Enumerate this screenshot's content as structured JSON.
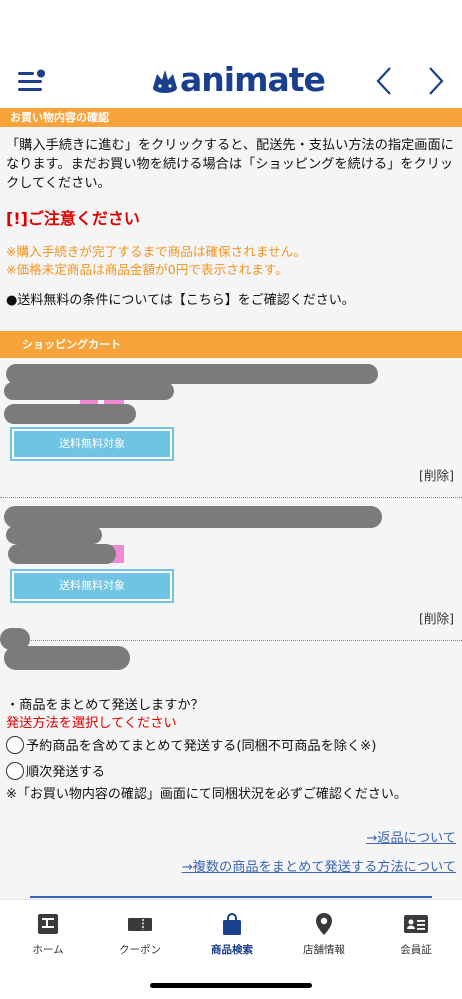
{
  "header": {
    "logo_text": "animate",
    "brand_color": "#1a3f8c"
  },
  "confirm_section": {
    "title": "お買い物内容の確認",
    "intro": "「購入手続きに進む」をクリックすると、配送先・支払い方法の指定画面になります。まだお買い物を続ける場合は「ショッピングを続ける」をクリックしてください。",
    "caution_title": "[!]ご注意ください",
    "notes": [
      "※購入手続きが完了するまで商品は確保されません。",
      "※価格未定商品は商品金額が0円で表示されます。"
    ],
    "shipping_note": "●送料無料の条件については【こちら】をご確認ください。"
  },
  "cart_section": {
    "title": "ショッピングカート",
    "items": [
      {
        "badge": "送料無料対象",
        "delete_label": "[削除]"
      },
      {
        "badge": "送料無料対象",
        "delete_label": "[削除]"
      }
    ]
  },
  "shipping_options": {
    "question": "・商品をまとめて発送しますか？",
    "prompt": "発送方法を選択してください",
    "options": [
      "予約商品を含めてまとめて発送する(同梱不可商品を除く※)",
      "順次発送する"
    ],
    "bundle_note": "※「お買い物内容の確認」画面にて同梱状況を必ずご確認ください。"
  },
  "links": {
    "returns": "→返品について",
    "bundle_method": "→複数の商品をまとめて発送する方法について"
  },
  "tabbar": {
    "tabs": [
      {
        "label": "ホーム",
        "icon": "home-icon"
      },
      {
        "label": "クーポン",
        "icon": "coupon-icon"
      },
      {
        "label": "商品検索",
        "icon": "shopping-bag-icon"
      },
      {
        "label": "店舗情報",
        "icon": "map-pin-icon"
      },
      {
        "label": "会員証",
        "icon": "member-card-icon"
      }
    ],
    "active_index": 2
  },
  "colors": {
    "accent_orange": "#f8a33a",
    "notice_orange": "#f29522",
    "alert_red": "#e00000",
    "badge_blue": "#6fc4e3",
    "link_blue": "#3c66b5"
  }
}
